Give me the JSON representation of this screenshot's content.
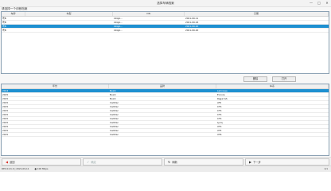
{
  "window": {
    "title": "选择车辆档案",
    "minimize_glyph": "—",
    "maximize_glyph": "□",
    "close_glyph": "✕"
  },
  "prompt": "请选择一个诊断档案",
  "top_table": {
    "columns": [
      "车牌",
      "车型",
      "VIN",
      "日期"
    ],
    "rows": [
      {
        "plate": "粤B",
        "model": "",
        "vin": "LSGJA...",
        "date": "2021-09-11",
        "selected": false
      },
      {
        "plate": "粤B",
        "model": "",
        "vin": "LSGJA...",
        "date": "2021-09-16",
        "selected": false
      },
      {
        "plate": "粤B",
        "model": "",
        "vin": "LSGJA...",
        "date": "2021-09-20",
        "selected": true
      },
      {
        "plate": "粤B",
        "model": "",
        "vin": "LSGJA...",
        "date": "2021-09-20",
        "selected": false
      }
    ]
  },
  "buttons": {
    "delete": "删除",
    "open": "打开"
  },
  "bottom_table": {
    "columns": [
      "年份",
      "品牌",
      "车系"
    ],
    "rows": [
      {
        "year": "2014",
        "make": "Buick",
        "model": "LaCrosse",
        "selected": true
      },
      {
        "year": "2015",
        "make": "Buick",
        "model": "Encore",
        "selected": false
      },
      {
        "year": "2015",
        "make": "Buick",
        "model": "Regal GS",
        "selected": false
      },
      {
        "year": "2015",
        "make": "Cadillac",
        "model": "ATS",
        "selected": false
      },
      {
        "year": "2015",
        "make": "Cadillac",
        "model": "CTS",
        "selected": false
      },
      {
        "year": "2015",
        "make": "Cadillac",
        "model": "CTS",
        "selected": false
      },
      {
        "year": "2015",
        "make": "Cadillac",
        "model": "CTS",
        "selected": false
      },
      {
        "year": "2015",
        "make": "Cadillac",
        "model": "CTS",
        "selected": false
      },
      {
        "year": "2015",
        "make": "Cadillac",
        "model": "Lyriq",
        "selected": false
      },
      {
        "year": "2015",
        "make": "Cadillac",
        "model": "XTS",
        "selected": false
      },
      {
        "year": "2015",
        "make": "Cadillac",
        "model": "XT5",
        "selected": false
      },
      {
        "year": "2015",
        "make": "Cadillac",
        "model": "XT6",
        "selected": false
      }
    ]
  },
  "bottom_bar": {
    "back": "返回",
    "ok": "确定",
    "refresh": "刷新",
    "next": "下一步"
  },
  "status": {
    "text": "DEV-0.21.0 | 2021-09-11",
    "connection": "100 Mbps",
    "page": "1/1"
  },
  "colors": {
    "accent": "#1e90d1",
    "close": "#d9342b"
  }
}
